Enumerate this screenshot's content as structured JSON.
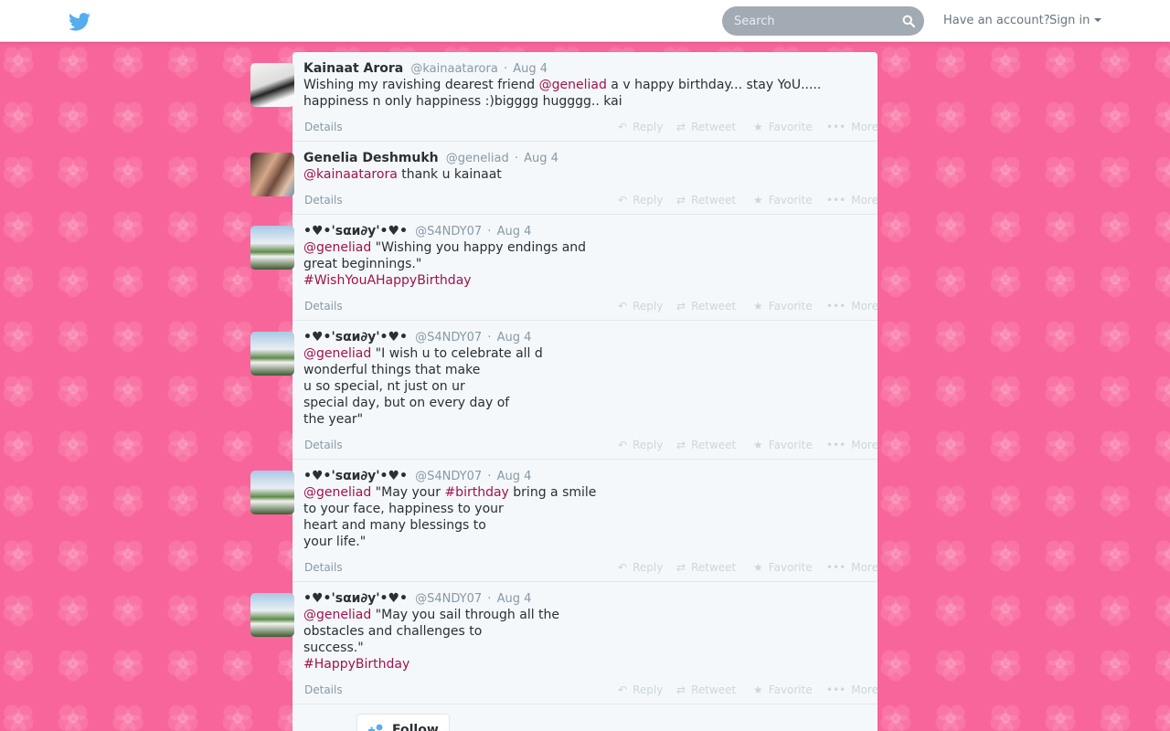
{
  "header": {
    "search_placeholder": "Search",
    "have_account": "Have an account?",
    "sign_in": "Sign in"
  },
  "colors": {
    "background": "#f8659b",
    "link": "#a0124e",
    "topbar": "#ffffff"
  },
  "tweets": [
    {
      "fullname": "Kainaat Arora",
      "username": "@kainaatarora",
      "time": "Aug 4",
      "parts": [
        {
          "t": "Wishing my ravishing dearest friend ",
          "link": false
        },
        {
          "t": "@geneliad",
          "link": true
        },
        {
          "t": " a v happy birthday... stay YoU..... happiness n only happiness :)bigggg hugggg.. kai",
          "link": false
        }
      ]
    },
    {
      "fullname": "Genelia Deshmukh",
      "username": "@geneliad",
      "time": "Aug 4",
      "parts": [
        {
          "t": "@kainaatarora",
          "link": true
        },
        {
          "t": " thank u kainaat",
          "link": false
        }
      ]
    },
    {
      "fullname": "•♥•'ѕαи∂у'•♥•",
      "username": "@S4NDY07",
      "time": "Aug 4",
      "parts": [
        {
          "t": "@geneliad",
          "link": true
        },
        {
          "t": " \"Wishing you happy endings and\ngreat beginnings.\"\n",
          "link": false
        },
        {
          "t": "#WishYouAHappyBirthday",
          "link": true
        }
      ]
    },
    {
      "fullname": "•♥•'ѕαи∂у'•♥•",
      "username": "@S4NDY07",
      "time": "Aug 4",
      "parts": [
        {
          "t": "@geneliad",
          "link": true
        },
        {
          "t": " \"I wish u to celebrate all d\nwonderful things that make\nu so special, nt just on ur\nspecial day, but on every day of\nthe year\"",
          "link": false
        }
      ]
    },
    {
      "fullname": "•♥•'ѕαи∂у'•♥•",
      "username": "@S4NDY07",
      "time": "Aug 4",
      "parts": [
        {
          "t": "@geneliad",
          "link": true
        },
        {
          "t": " \"May your ",
          "link": false
        },
        {
          "t": "#birthday",
          "link": true
        },
        {
          "t": " bring a smile\nto your face, happiness to your\nheart and many blessings to\nyour life.\"",
          "link": false
        }
      ]
    },
    {
      "fullname": "•♥•'ѕαи∂у'•♥•",
      "username": "@S4NDY07",
      "time": "Aug 4",
      "parts": [
        {
          "t": "@geneliad",
          "link": true
        },
        {
          "t": " \"May you sail through all the\nobstacles and challenges to\nsuccess.\"\n",
          "link": false
        },
        {
          "t": "#HappyBirthday",
          "link": true
        }
      ]
    }
  ],
  "actions": {
    "details": "Details",
    "reply": "Reply",
    "retweet": "Retweet",
    "favorite": "Favorite",
    "more": "More"
  },
  "follow_label": "Follow"
}
